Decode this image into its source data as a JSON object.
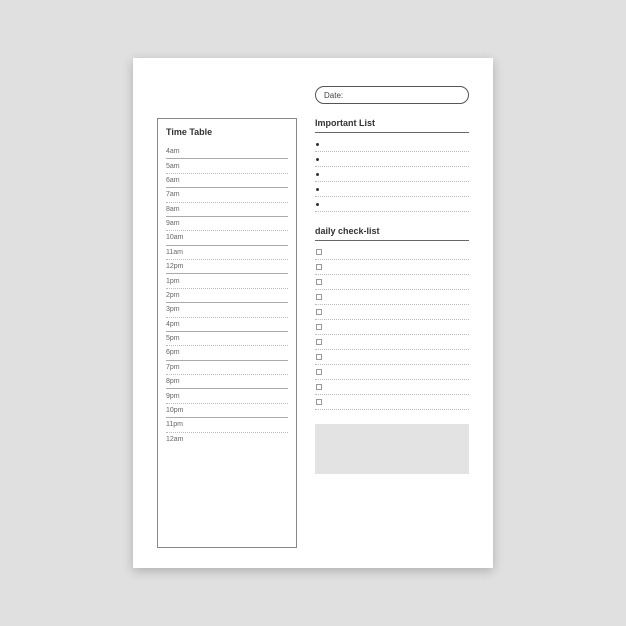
{
  "date_label": "Date:",
  "timetable": {
    "heading": "Time Table",
    "rows": [
      {
        "label": "4am",
        "style": "solid"
      },
      {
        "label": "5am",
        "style": "dotted"
      },
      {
        "label": "6am",
        "style": "solid"
      },
      {
        "label": "7am",
        "style": "dotted"
      },
      {
        "label": "8am",
        "style": "solid"
      },
      {
        "label": "9am",
        "style": "dotted"
      },
      {
        "label": "10am",
        "style": "solid"
      },
      {
        "label": "11am",
        "style": "dotted"
      },
      {
        "label": "12pm",
        "style": "solid"
      },
      {
        "label": "1pm",
        "style": "dotted"
      },
      {
        "label": "2pm",
        "style": "solid"
      },
      {
        "label": "3pm",
        "style": "dotted"
      },
      {
        "label": "4pm",
        "style": "solid"
      },
      {
        "label": "5pm",
        "style": "dotted"
      },
      {
        "label": "6pm",
        "style": "solid"
      },
      {
        "label": "7pm",
        "style": "dotted"
      },
      {
        "label": "8pm",
        "style": "solid"
      },
      {
        "label": "9pm",
        "style": "dotted"
      },
      {
        "label": "10pm",
        "style": "solid"
      },
      {
        "label": "11pm",
        "style": "dotted"
      },
      {
        "label": "12am",
        "style": "solid"
      }
    ]
  },
  "important": {
    "heading": "Important List",
    "count": 5
  },
  "checklist": {
    "heading": "daily check-list",
    "count": 11
  }
}
